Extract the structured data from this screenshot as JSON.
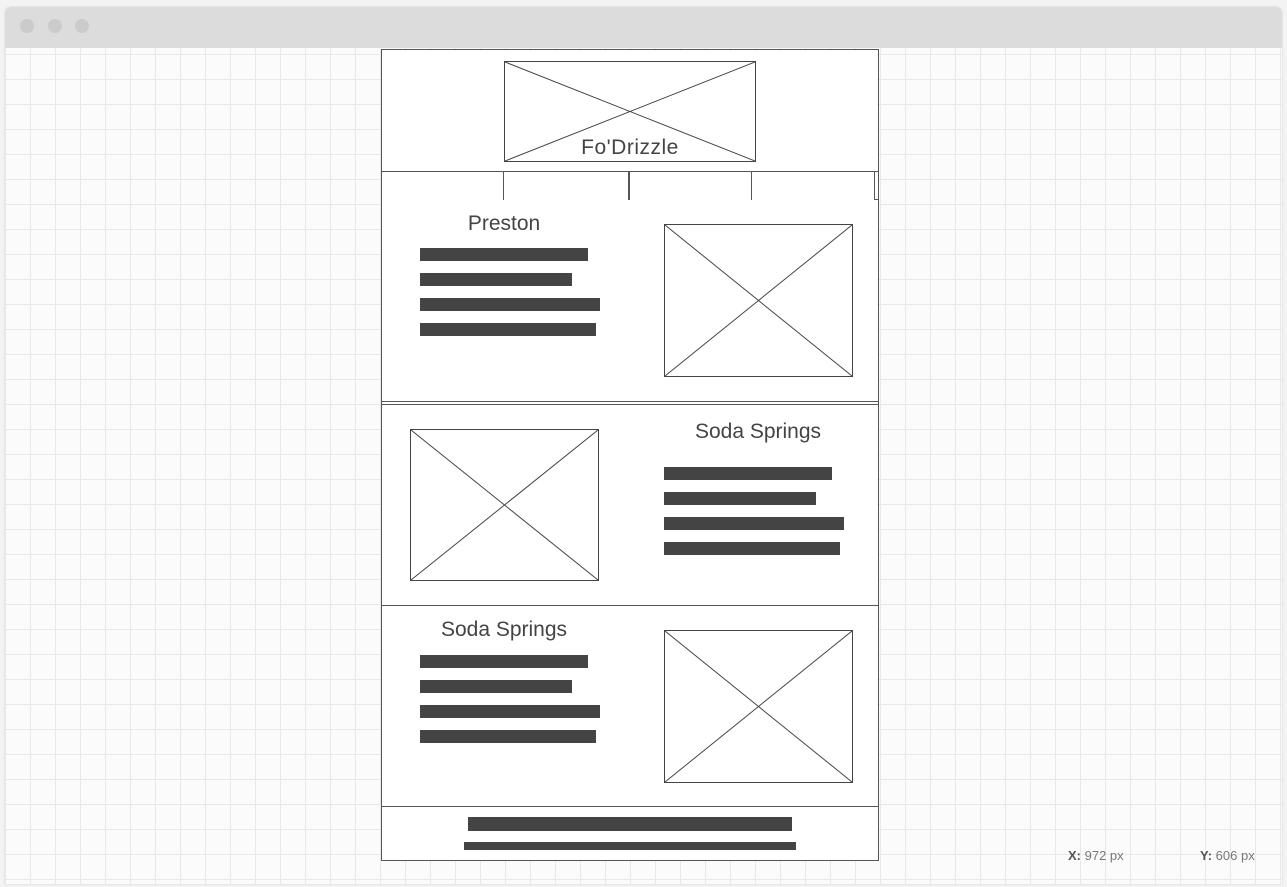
{
  "site": {
    "logo_text": "Fo'Drizzle"
  },
  "nav": {
    "tabs": [
      "",
      "",
      "",
      ""
    ]
  },
  "sections": [
    {
      "heading": "Preston"
    },
    {
      "heading": "Soda Springs"
    },
    {
      "heading": "Soda Springs"
    }
  ],
  "status": {
    "x_label": "X:",
    "x_value": "972 px",
    "y_label": "Y:",
    "y_value": "606 px"
  },
  "colors": {
    "wire": "#444444",
    "titlebar": "#dcdcdc",
    "grid": "#e8e8e8"
  }
}
